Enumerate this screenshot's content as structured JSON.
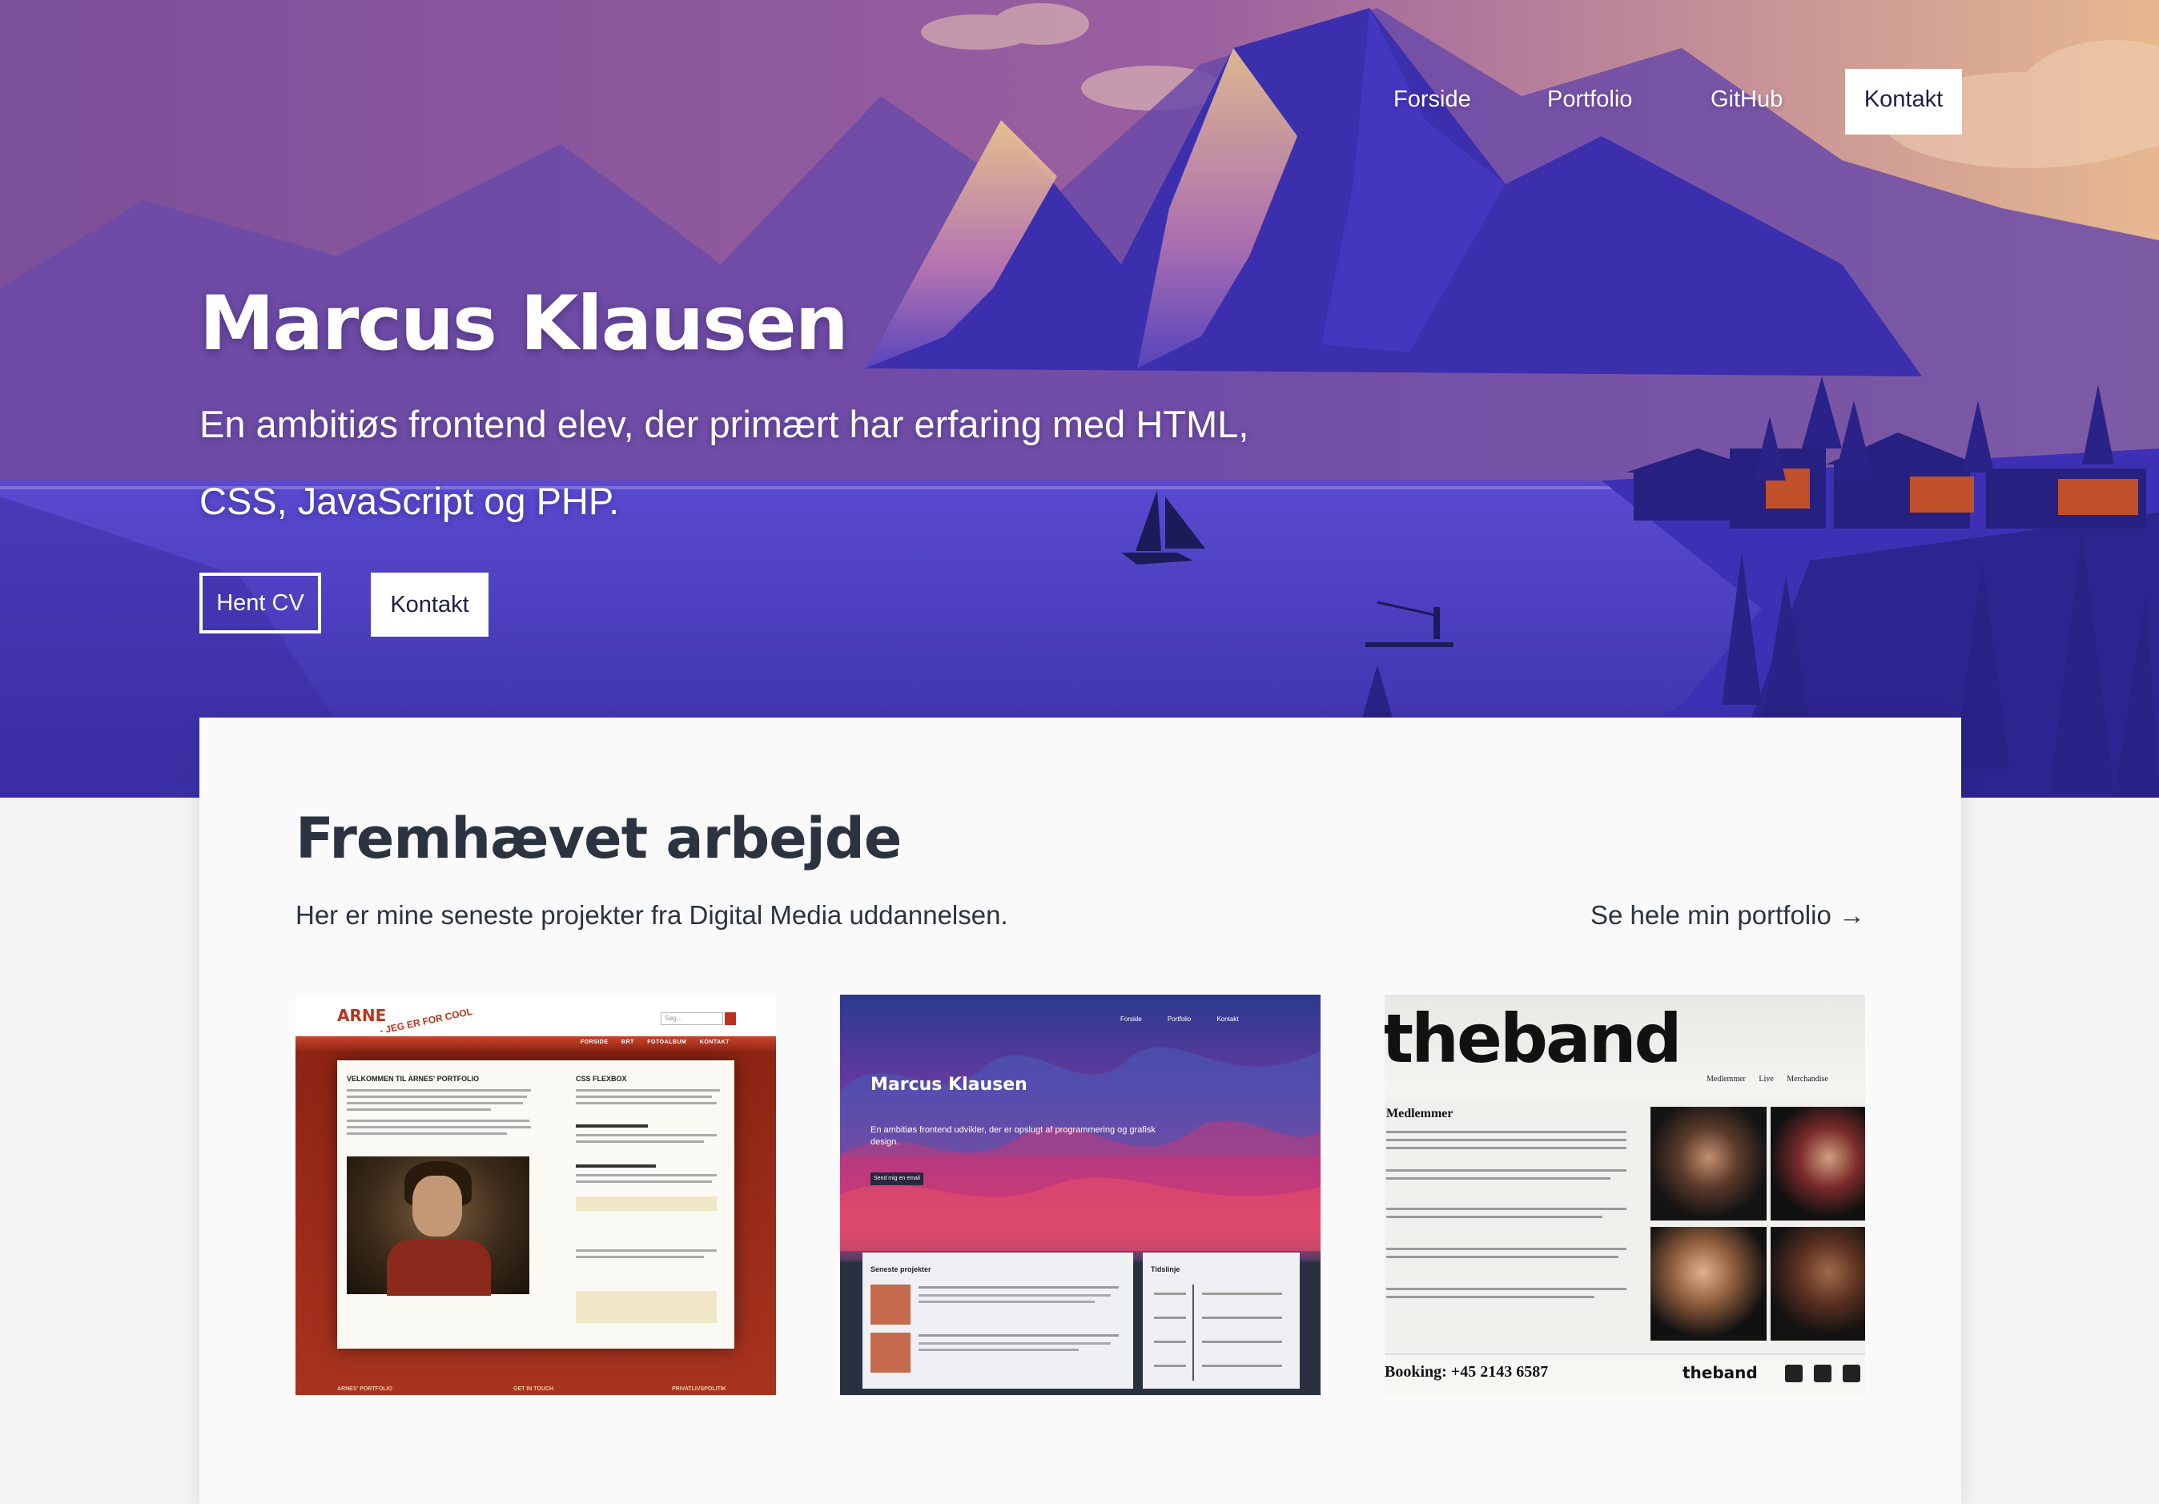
{
  "nav": {
    "items": [
      "Forside",
      "Portfolio",
      "GitHub"
    ],
    "cta": "Kontakt"
  },
  "hero": {
    "title": "Marcus Klausen",
    "subtitle": "En ambitiøs frontend elev, der primært har erfaring med HTML, CSS, JavaScript og PHP.",
    "btn_cv": "Hent CV",
    "btn_contact": "Kontakt"
  },
  "featured": {
    "title": "Fremhævet arbejde",
    "description": "Her er mine seneste projekter fra Digital Media uddannelsen.",
    "link": "Se hele min portfolio →"
  },
  "projects": [
    {
      "logo": "ARNE",
      "tagline": "- JEG ER FOR COOL",
      "menu": "FORSIDE BRT FOTOALBUM KONTAKT",
      "search": "Søg...",
      "heading": "VELKOMMEN TIL ARNES' PORTFOLIO",
      "side_heading": "CSS FLEXBOX",
      "footer": [
        "ARNES' PORTFOLIO",
        "GET IN TOUCH",
        "PRIVATLIVSPOLITIK"
      ]
    },
    {
      "title": "Marcus Klausen",
      "subtitle": "En ambitiøs frontend udvikler, der er opslugt af programmering og grafisk design.",
      "button": "Send mig en email",
      "nav": "Forside Portfolio Kontakt",
      "panel1": "Seneste projekter",
      "panel2": "Tidslinje"
    },
    {
      "logo": "theband",
      "menu": "Medlemmer Live Merchandise",
      "heading": "Medlemmer",
      "booking": "Booking: +45 2143 6587",
      "footer_logo": "theband"
    }
  ],
  "colors": {
    "hero_purple": "#4a3aa8",
    "text_dark": "#2c3340",
    "button_text": "#1f1d4a"
  }
}
